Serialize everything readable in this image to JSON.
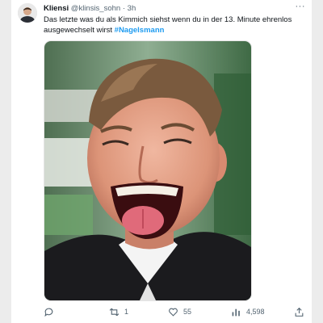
{
  "tweet": {
    "author_name": "Kliensi",
    "author_handle": "@klinsis_sohn",
    "separator": "·",
    "time": "3h",
    "more": "···",
    "text_part1": "Das letzte was du als Kimmich siehst wenn du in der 13. Minute ehrenlos ausgewechselt wirst ",
    "hashtag": "#Nagelsmann",
    "media_icon": "photo-laughing-man",
    "actions": {
      "reply": {
        "icon": "reply-icon",
        "count": ""
      },
      "retweet": {
        "icon": "retweet-icon",
        "count": "1"
      },
      "like": {
        "icon": "heart-icon",
        "count": "55"
      },
      "views": {
        "icon": "views-bar-chart-icon",
        "count": "4,598"
      },
      "share": {
        "icon": "share-icon"
      }
    }
  },
  "colors": {
    "link": "#1d9bf0",
    "muted": "#536471",
    "text": "#0f1419"
  }
}
